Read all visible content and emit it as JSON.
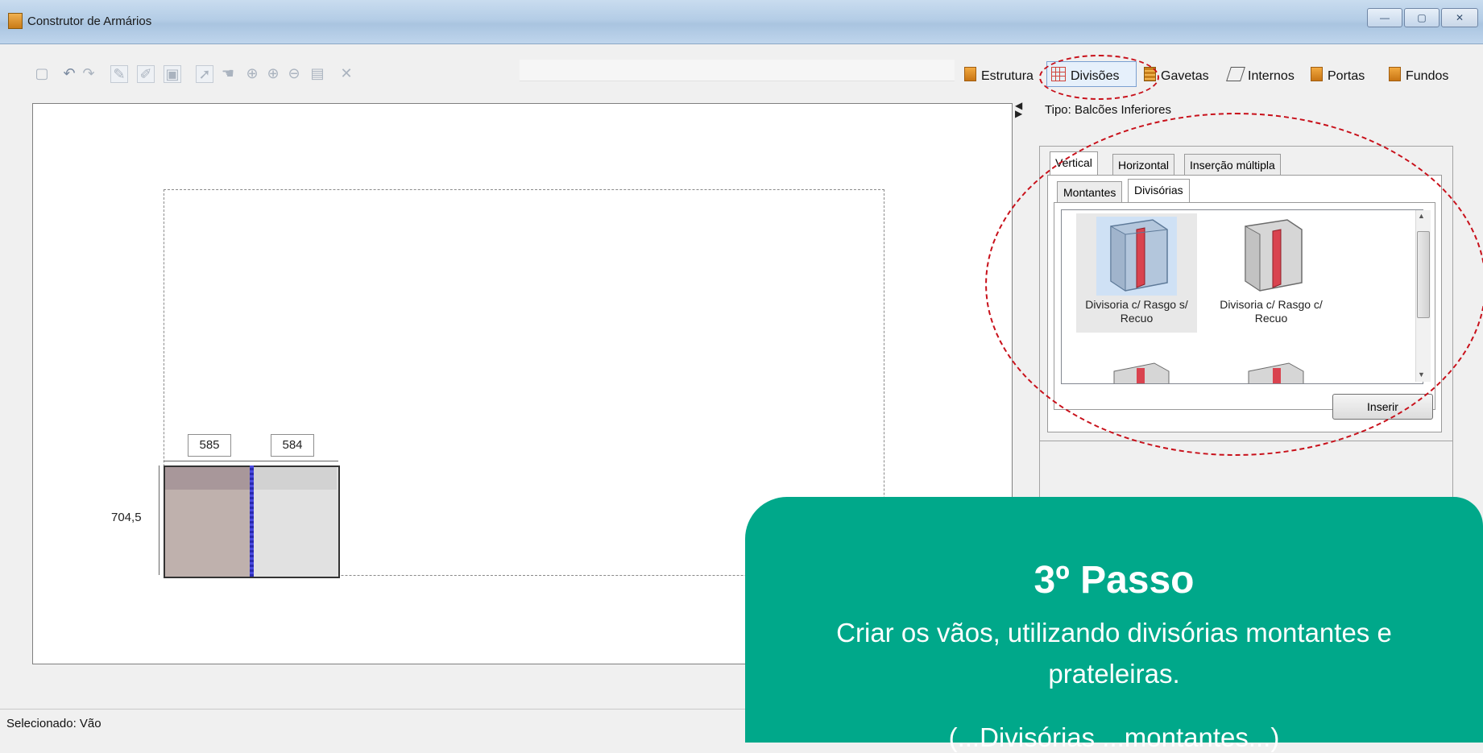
{
  "window": {
    "title": "Construtor de Armários",
    "controls": [
      "—",
      "▢",
      "✕"
    ]
  },
  "toolbar": {
    "icons": [
      "new-icon",
      "undo-icon",
      "redo-icon",
      "pencil-icon",
      "edit-icon",
      "frame-icon",
      "pointer-icon",
      "hand-icon",
      "zoom-region-icon",
      "zoom-in-icon",
      "zoom-out-icon",
      "window-icon",
      "delete-icon"
    ],
    "tabs": [
      {
        "label": "Estrutura",
        "icon": "wood-panel-icon"
      },
      {
        "label": "Divisões",
        "icon": "grid-icon"
      },
      {
        "label": "Gavetas",
        "icon": "drawer-icon"
      },
      {
        "label": "Internos",
        "icon": "internal-icon"
      },
      {
        "label": "Portas",
        "icon": "door-icon"
      },
      {
        "label": "Fundos",
        "icon": "back-panel-icon"
      }
    ]
  },
  "canvas": {
    "dimensions": {
      "width_left": "585",
      "width_right": "584",
      "height": "704,5"
    }
  },
  "status": {
    "text": "Selecionado: Vão"
  },
  "panel": {
    "tipo": "Tipo: Balcões Inferiores",
    "tabs": [
      "Vertical",
      "Horizontal",
      "Inserção múltipla"
    ],
    "subtabs": [
      "Montantes",
      "Divisórias"
    ],
    "items": [
      {
        "label_line1": "Divisoria c/ Rasgo s/",
        "label_line2": "Recuo"
      },
      {
        "label_line1": "Divisoria c/ Rasgo c/",
        "label_line2": "Recuo"
      }
    ],
    "insert_button": "Inserir"
  },
  "card": {
    "title": "3º Passo",
    "text": "Criar os vãos, utilizando divisórias montantes e prateleiras.",
    "cut_text": "(...Divisórias ...montantes...)"
  },
  "colors": {
    "accent": "#00a88a",
    "highlight": "#c8101a",
    "divider": "#3a3ad0"
  }
}
